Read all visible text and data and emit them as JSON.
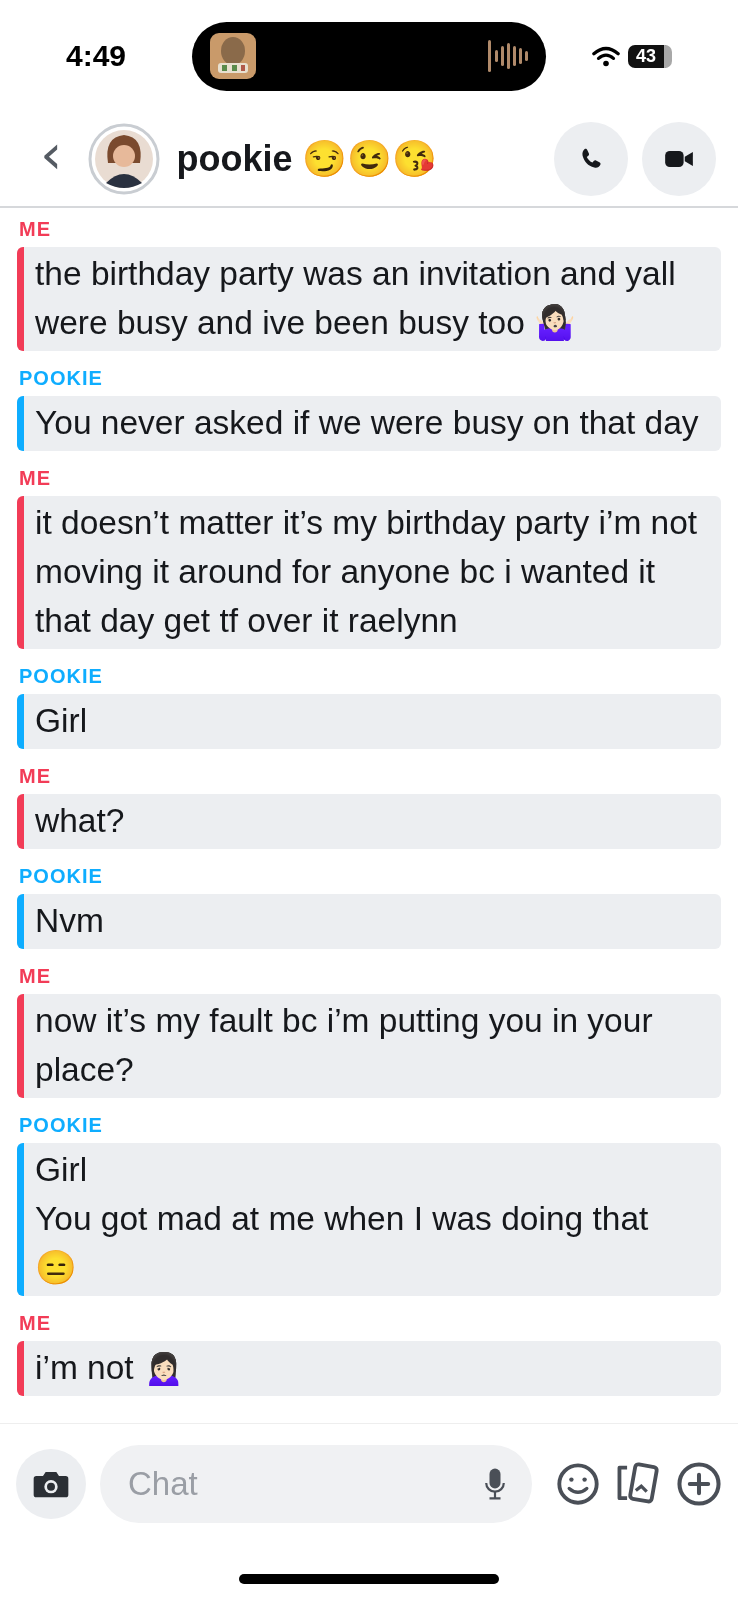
{
  "status_bar": {
    "time": "4:49",
    "battery": "43"
  },
  "header": {
    "back": "‹",
    "name": "pookie 😏😉😘"
  },
  "messages": [
    {
      "sender": "ME",
      "kind": "me",
      "text": "the birthday party was an invitation and yall were busy and ive been busy too 🤷🏻‍♀️"
    },
    {
      "sender": "POOKIE",
      "kind": "friend",
      "text": "You never asked if we were busy on that day"
    },
    {
      "sender": "ME",
      "kind": "me",
      "text": "it doesn’t matter it’s my birthday party i’m not moving it around for anyone bc i wanted it that day get tf over it raelynn"
    },
    {
      "sender": "POOKIE",
      "kind": "friend",
      "text": "Girl"
    },
    {
      "sender": "ME",
      "kind": "me",
      "text": "what?"
    },
    {
      "sender": "POOKIE",
      "kind": "friend",
      "text": "Nvm"
    },
    {
      "sender": "ME",
      "kind": "me",
      "text": "now it’s my fault bc i’m putting you in your place?"
    },
    {
      "sender": "POOKIE",
      "kind": "friend",
      "text": "Girl\nYou got mad at me when I was doing that\n😑"
    },
    {
      "sender": "ME",
      "kind": "me",
      "text": "i’m not 🙍🏻‍♀️"
    }
  ],
  "composer": {
    "placeholder": "Chat"
  }
}
